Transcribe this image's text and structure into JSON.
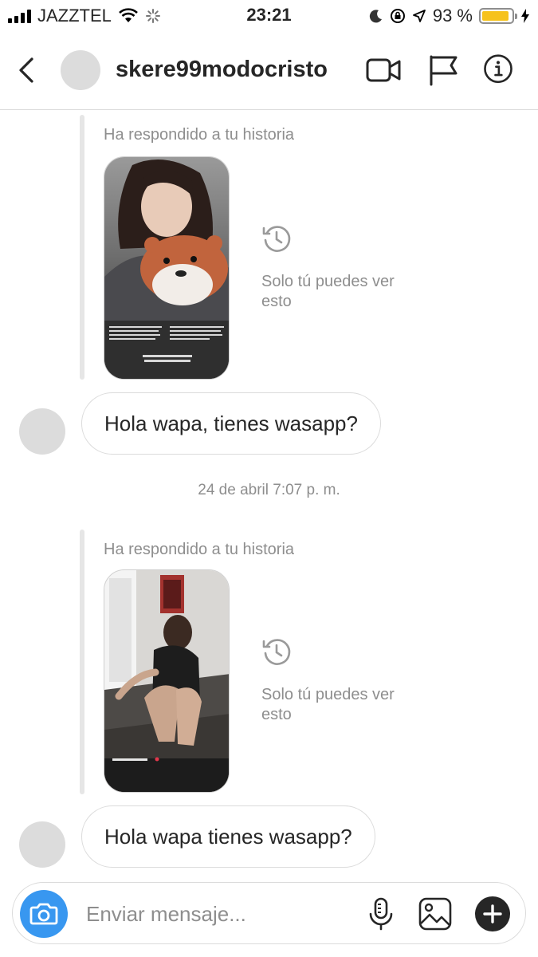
{
  "status_bar": {
    "carrier": "JAZZTEL",
    "time": "23:21",
    "battery_percent": "93 %",
    "battery_level": 0.93,
    "battery_color": "#f6c21c"
  },
  "header": {
    "username": "skere99modocristo",
    "icons": [
      "chevron-left-icon",
      "video-camera-icon",
      "flag-icon",
      "info-icon"
    ]
  },
  "thread": {
    "story_replies": [
      {
        "label": "Ha respondido a tu historia",
        "only_you_text": "Solo tú puedes ver esto",
        "message": "Hola wapa, tienes wasapp?"
      },
      {
        "label": "Ha respondido a tu historia",
        "only_you_text": "Solo tú puedes ver esto",
        "message": "Hola wapa tienes wasapp?"
      }
    ],
    "timestamp": "24 de abril 7:07 p. m."
  },
  "composer": {
    "placeholder": "Enviar mensaje...",
    "accent_color": "#3897f0",
    "icons": [
      "camera-icon",
      "microphone-icon",
      "image-icon",
      "plus-icon"
    ]
  }
}
